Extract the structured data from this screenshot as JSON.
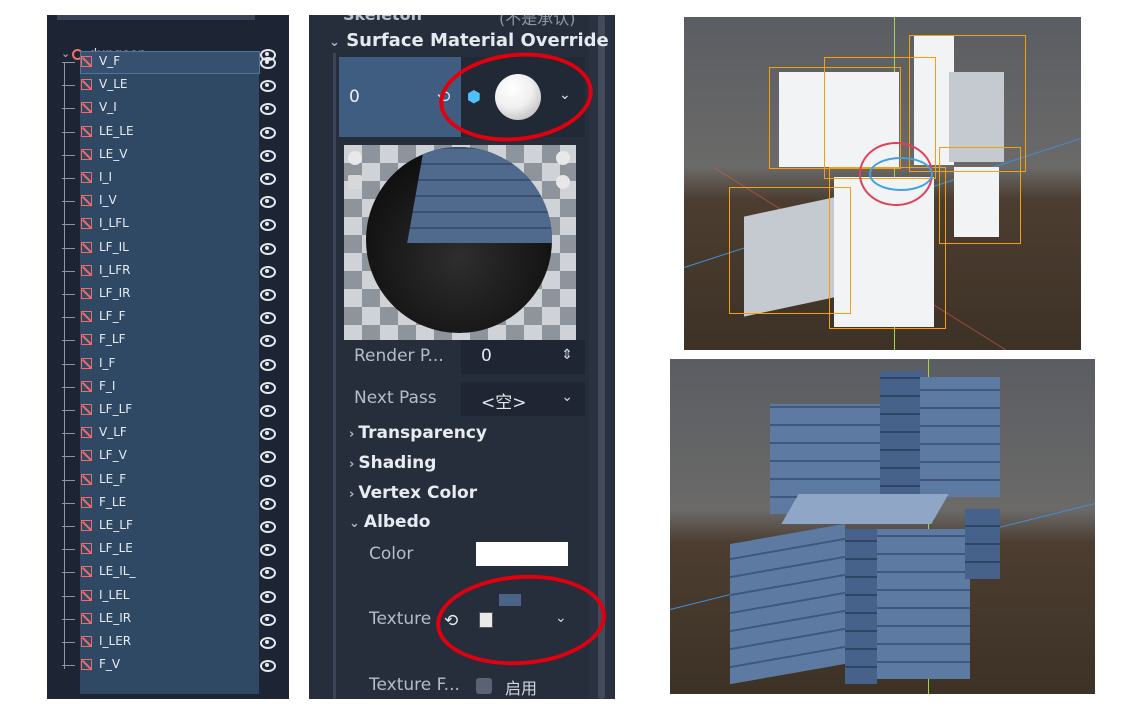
{
  "scene_tree": {
    "root": "dungeon",
    "nodes": [
      "V_F",
      "V_LE",
      "V_I",
      "LE_LE",
      "LE_V",
      "I_I",
      "I_V",
      "I_LFL",
      "LF_IL",
      "I_LFR",
      "LF_IR",
      "LF_F",
      "F_LF",
      "I_F",
      "F_I",
      "LF_LF",
      "V_LF",
      "LF_V",
      "LE_F",
      "F_LE",
      "LE_LF",
      "LF_LE",
      "LE_IL_",
      "I_LEL",
      "LE_IR",
      "I_LER",
      "F_V"
    ],
    "selected": "V_F"
  },
  "inspector": {
    "section_cut": "Skeleton",
    "section_cut_right": "(不是承认)",
    "section": "Surface Material Override",
    "slot_index": "0",
    "render_priority_label": "Render P...",
    "render_priority_value": "0",
    "next_pass_label": "Next Pass",
    "next_pass_value": "<空>",
    "categories": [
      "Transparency",
      "Shading",
      "Vertex Color"
    ],
    "albedo": "Albedo",
    "color_label": "Color",
    "color_value": "#ffffff",
    "texture_label": "Texture",
    "texture_filter_label": "Texture F...",
    "enable_label": "启用"
  },
  "icons": {
    "expand": "chevron-down-icon",
    "collapsed": "chevron-right-icon",
    "revert": "revert-icon",
    "visibility": "eye-icon"
  },
  "accent": {
    "highlight": "#e0000f",
    "selection": "#f0a010"
  }
}
